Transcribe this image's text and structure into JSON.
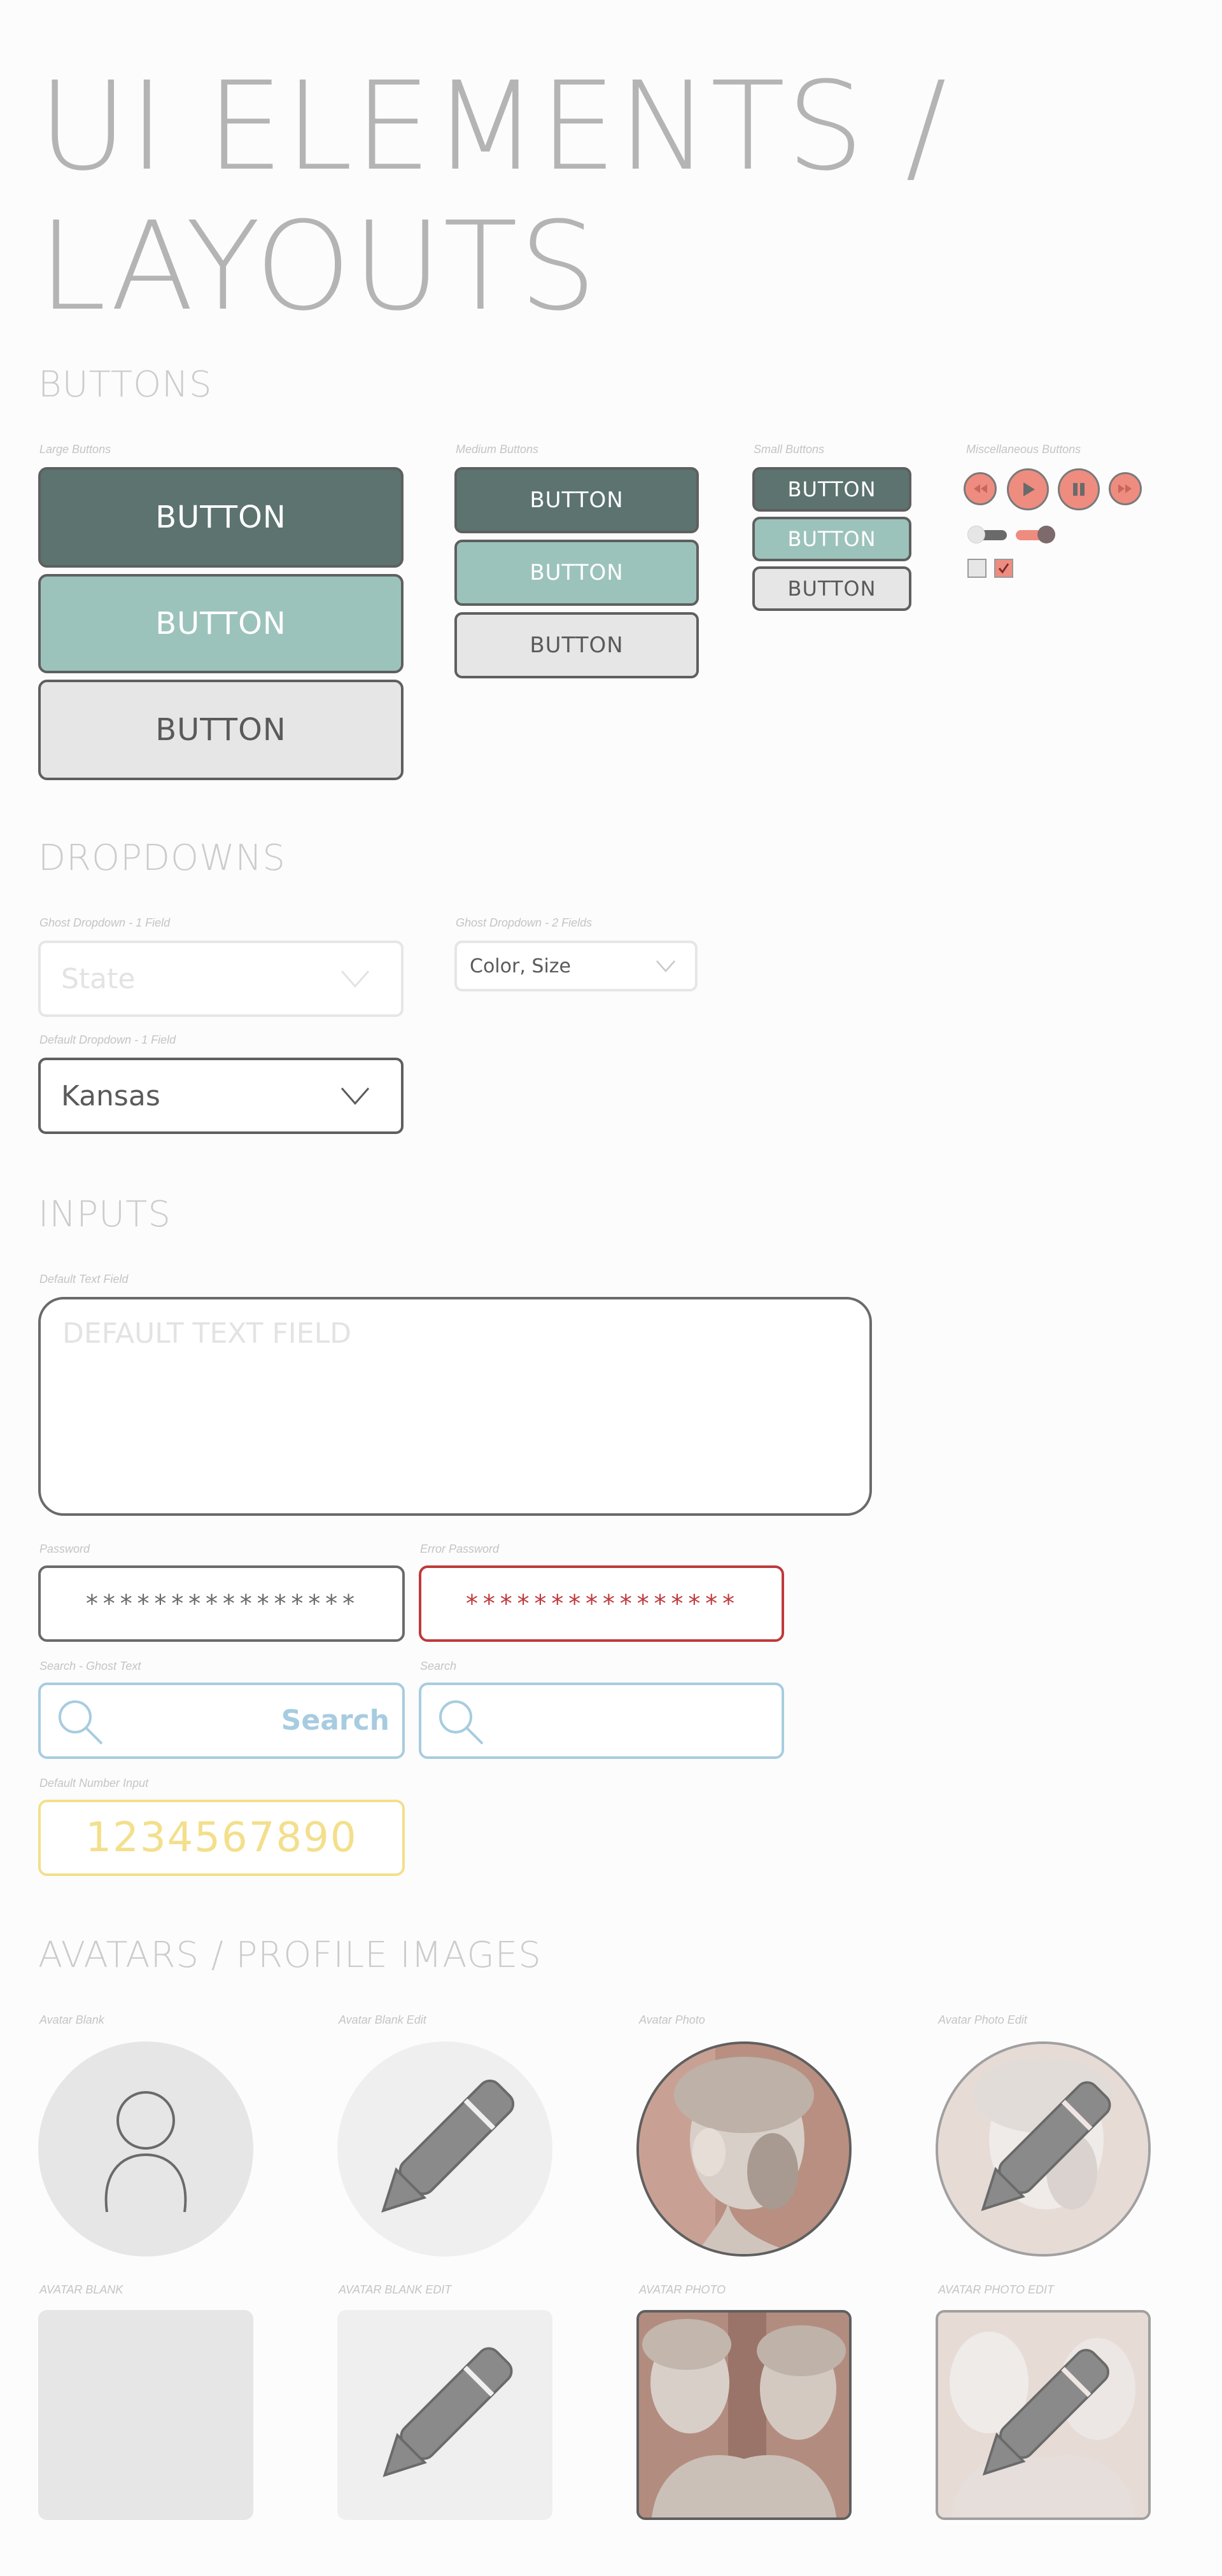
{
  "page_title": "UI ELEMENTS /\nLAYOUTS",
  "sections": {
    "buttons": "BUTTONS",
    "dropdowns": "DROPDOWNS",
    "inputs": "INPUTS",
    "avatars": "AVATARS / PROFILE IMAGES"
  },
  "buttons": {
    "large_label": "Large Buttons",
    "medium_label": "Medium Buttons",
    "small_label": "Small Buttons",
    "misc_label": "Miscellaneous Buttons",
    "button_text": "BUTTON",
    "colors": {
      "dark": "#5c7370",
      "teal": "#9cc3bb",
      "light": "#e6e6e6",
      "accent": "#ef8c80"
    },
    "misc_icons": [
      "rewind-icon",
      "play-icon",
      "pause-icon",
      "fast-forward-icon"
    ],
    "toggles": [
      {
        "state": "off"
      },
      {
        "state": "on"
      }
    ],
    "checkboxes": [
      {
        "checked": false
      },
      {
        "checked": true
      }
    ]
  },
  "dropdowns": {
    "ghost1_label": "Ghost Dropdown - 1 Field",
    "ghost1_value": "State",
    "ghost2_label": "Ghost Dropdown - 2 Fields",
    "ghost2_value": "Color, Size",
    "default_label": "Default Dropdown - 1 Field",
    "default_value": "Kansas"
  },
  "inputs": {
    "text_label": "Default Text Field",
    "text_placeholder": "DEFAULT TEXT FIELD",
    "password_label": "Password",
    "password_value": "****************",
    "error_password_label": "Error Password",
    "error_password_value": "****************",
    "search_ghost_label": "Search - Ghost Text",
    "search_ghost_placeholder": "Search",
    "search_label": "Search",
    "number_label": "Default Number Input",
    "number_value": "1234567890",
    "colors": {
      "error": "#c0393b",
      "search": "#a7cce0",
      "number": "#f3df8c"
    }
  },
  "avatars": {
    "circle_labels": [
      "Avatar Blank",
      "Avatar Blank Edit",
      "Avatar Photo",
      "Avatar Photo Edit"
    ],
    "square_labels": [
      "AVATAR BLANK",
      "AVATAR BLANK EDIT",
      "AVATAR PHOTO",
      "AVATAR PHOTO EDIT"
    ]
  }
}
